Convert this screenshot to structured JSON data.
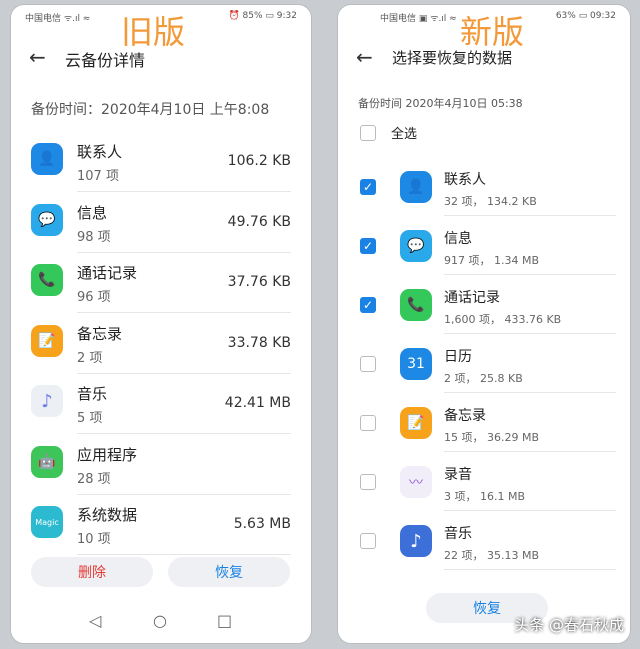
{
  "old": {
    "badge": "旧版",
    "status_left": "中国电信 ᯤ.ıl ≈",
    "status_right": "⏰ 85% ▭ 9:32",
    "back_icon": "back-arrow-icon",
    "title": "云备份详情",
    "backup_time": "备份时间：2020年4月10日 上午8:08",
    "items": [
      {
        "name": "联系人",
        "count": "107 项",
        "size": "106.2 KB",
        "color": "#1e88e5",
        "glyph": "👤"
      },
      {
        "name": "信息",
        "count": "98 项",
        "size": "49.76 KB",
        "color": "#29a8ea",
        "glyph": "💬"
      },
      {
        "name": "通话记录",
        "count": "96 项",
        "size": "37.76 KB",
        "color": "#34c759",
        "glyph": "📞"
      },
      {
        "name": "备忘录",
        "count": "2 项",
        "size": "33.78 KB",
        "color": "#f7a21b",
        "glyph": "📝"
      },
      {
        "name": "音乐",
        "count": "5 项",
        "size": "42.41 MB",
        "color": "#eceff4",
        "glyph": "♪"
      },
      {
        "name": "应用程序",
        "count": "28 项",
        "size": "",
        "color": "#3ec55a",
        "glyph": "🤖"
      },
      {
        "name": "系统数据",
        "count": "10 项",
        "size": "5.63 MB",
        "color": "#2bbad0",
        "glyph": "Magic"
      }
    ],
    "delete_label": "删除",
    "restore_label": "恢复",
    "nav": [
      "◁",
      "○",
      "□"
    ]
  },
  "new": {
    "badge": "新版",
    "status_left": "中国电信 ▣ ᯤ.ıl ≈",
    "status_right": "63% ▭ 09:32",
    "back_icon": "back-arrow-icon",
    "title": "选择要恢复的数据",
    "backup_time": "备份时间 2020年4月10日 05:38",
    "select_all": "全选",
    "items": [
      {
        "name": "联系人",
        "detail": "32 项， 134.2 KB",
        "checked": true,
        "color": "#1e88e5",
        "glyph": "👤"
      },
      {
        "name": "信息",
        "detail": "917 项， 1.34 MB",
        "checked": true,
        "color": "#29a8ea",
        "glyph": "💬"
      },
      {
        "name": "通话记录",
        "detail": "1,600 项， 433.76 KB",
        "checked": true,
        "color": "#34c759",
        "glyph": "📞"
      },
      {
        "name": "日历",
        "detail": "2 项， 25.8 KB",
        "checked": false,
        "color": "#1e88e5",
        "glyph": "31"
      },
      {
        "name": "备忘录",
        "detail": "15 项， 36.29 MB",
        "checked": false,
        "color": "#f7a21b",
        "glyph": "📝"
      },
      {
        "name": "录音",
        "detail": "3 项， 16.1 MB",
        "checked": false,
        "color": "#f2eef9",
        "glyph": "〰"
      },
      {
        "name": "音乐",
        "detail": "22 项， 35.13 MB",
        "checked": false,
        "color": "#3d6fd8",
        "glyph": "♪"
      }
    ],
    "restore_label": "恢复"
  },
  "watermark": "头条 @春石秋成",
  "colors": {
    "accent_red": "#e53935",
    "accent_blue": "#1a82e5",
    "badge_orange": "#f29a3a"
  }
}
